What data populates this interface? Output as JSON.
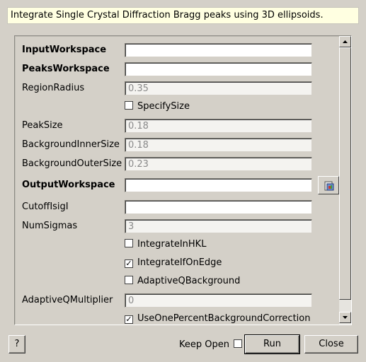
{
  "description": "Integrate Single Crystal Diffraction Bragg peaks using 3D ellipsoids.",
  "properties": {
    "input_workspace": {
      "label": "InputWorkspace",
      "value": ""
    },
    "peaks_workspace": {
      "label": "PeaksWorkspace",
      "value": ""
    },
    "region_radius": {
      "label": "RegionRadius",
      "value": "0.35"
    },
    "specify_size": {
      "label": "SpecifySize",
      "checked": false
    },
    "peak_size": {
      "label": "PeakSize",
      "value": "0.18"
    },
    "background_inner_size": {
      "label": "BackgroundInnerSize",
      "value": "0.18"
    },
    "background_outer_size": {
      "label": "BackgroundOuterSize",
      "value": "0.23"
    },
    "output_workspace": {
      "label": "OutputWorkspace",
      "value": ""
    },
    "cutoff_isigi": {
      "label": "CutoffIsigI",
      "value": ""
    },
    "num_sigmas": {
      "label": "NumSigmas",
      "value": "3"
    },
    "integrate_in_hkl": {
      "label": "IntegrateInHKL",
      "checked": false
    },
    "integrate_if_on_edge": {
      "label": "IntegrateIfOnEdge",
      "checked": true
    },
    "adaptive_q_background": {
      "label": "AdaptiveQBackground",
      "checked": false
    },
    "adaptive_q_multiplier": {
      "label": "AdaptiveQMultiplier",
      "value": "0"
    },
    "use_one_percent_background_correction": {
      "label": "UseOnePercentBackgroundCorrection",
      "checked": true
    }
  },
  "browse_button": {
    "icon": "folder-icon"
  },
  "footer": {
    "help_label": "?",
    "keep_open_label": "Keep Open",
    "keep_open_checked": false,
    "run_label": "Run",
    "close_label": "Close"
  }
}
